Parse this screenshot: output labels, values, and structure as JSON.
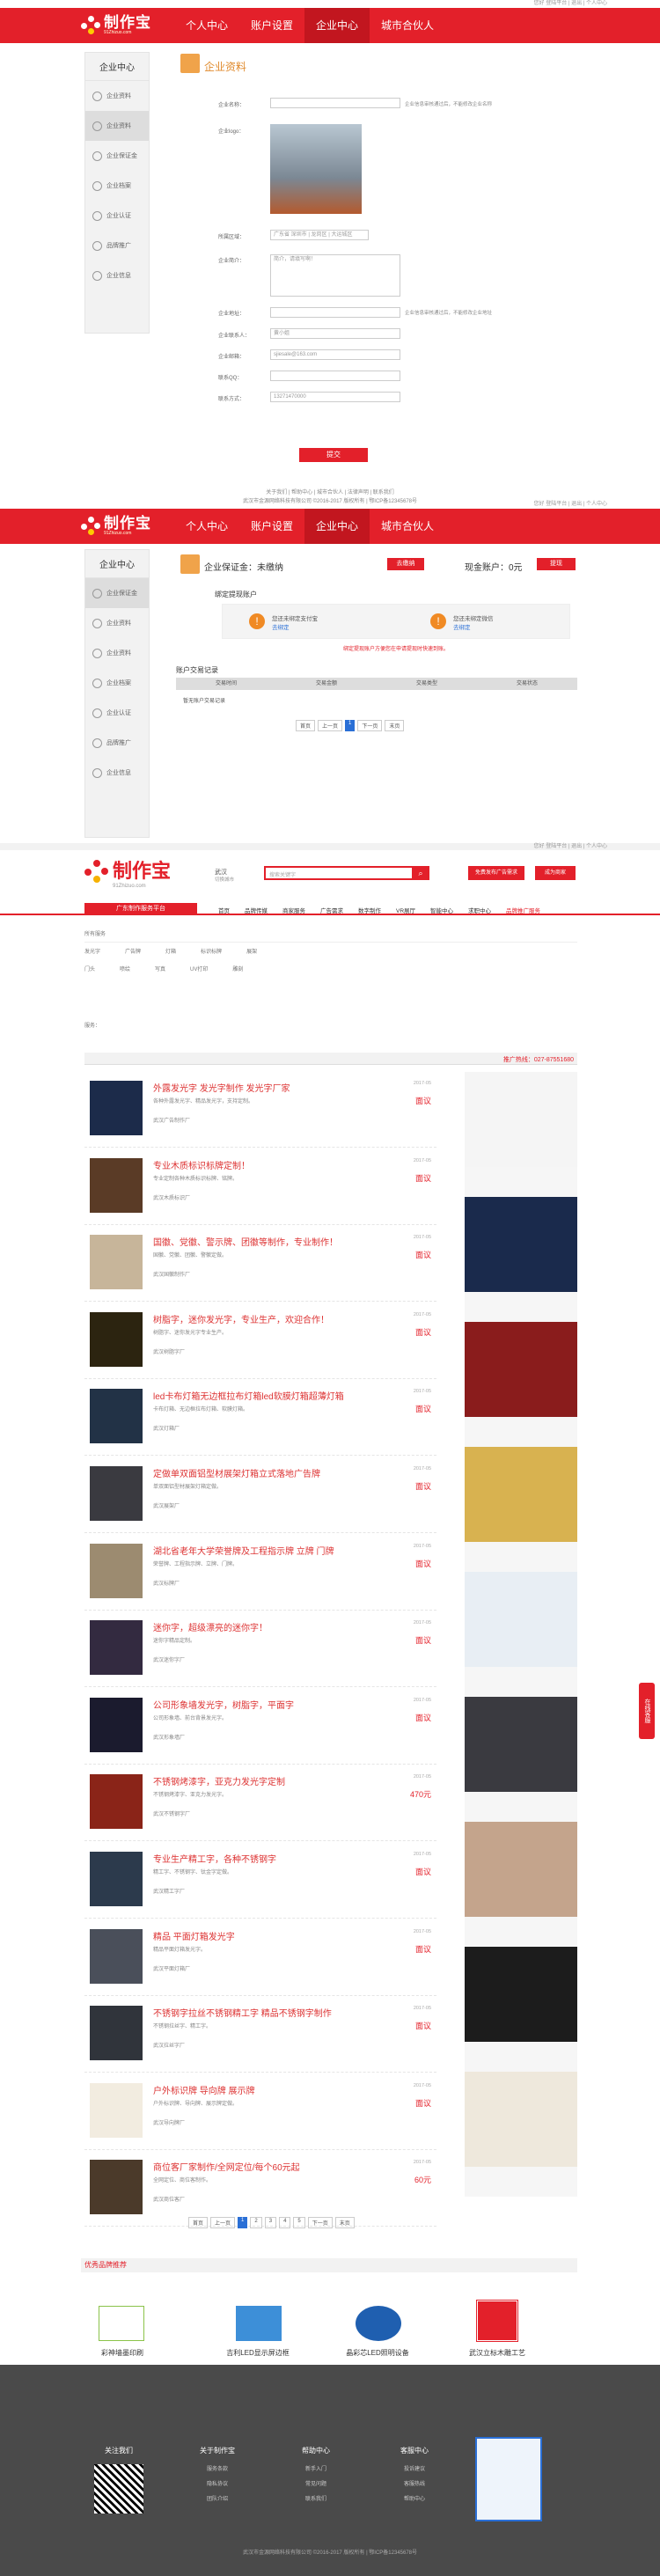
{
  "top_links": "您好 登陆平台 | 退出 | 个人中心",
  "logo": {
    "name": "制作宝",
    "url": "91Zhizuo.com"
  },
  "main_nav": [
    "个人中心",
    "账户设置",
    "企业中心",
    "城市合伙人"
  ],
  "sidebar": {
    "title": "企业中心",
    "items": [
      "企业资料",
      "企业资料",
      "企业保证金",
      "企业档案",
      "企业认证",
      "品牌推广",
      "企业信息"
    ]
  },
  "section1": {
    "title": "企业资料",
    "fields": [
      {
        "label": "企业名称：",
        "value": "",
        "tip": "企业信息审核通过后，不能修改企业名称"
      },
      {
        "label": "企业logo：",
        "value": ""
      },
      {
        "label": "所属区域：",
        "value": "广东省 深圳市 | 龙岗区 | 大运城区"
      },
      {
        "label": "企业简介：",
        "value": "简介，请填写啊！"
      },
      {
        "label": "企业地址：",
        "value": "",
        "tip": "企业信息审核通过后，不能修改企业地址"
      },
      {
        "label": "企业联系人：",
        "value": "黄小姐"
      },
      {
        "label": "企业邮箱：",
        "value": "sjiesale@163.com"
      },
      {
        "label": "联系QQ：",
        "value": ""
      },
      {
        "label": "联系方式：",
        "value": "13271470000"
      }
    ],
    "submit": "提交",
    "footer": "关于我们 | 帮助中心 | 城市合伙人 | 法律声明 | 联系我们",
    "copyright": "武汉市金源网络科技有限公司 ©2016-2017 版权所有 | 鄂ICP备12345678号"
  },
  "section2": {
    "deposit_label": "企业保证金：未缴纳",
    "deposit_btn": "去缴纳",
    "cash_label": "现金账户：0元",
    "cash_btn": "提现",
    "bind_title": "绑定提现账户",
    "bind1": "您还未绑定支付宝",
    "bind1_link": "去绑定",
    "bind2": "您还未绑定微信",
    "bind2_link": "去绑定",
    "notice": "绑定提现账户方便您在申请提现时快速到账。",
    "records_title": "账户交易记录",
    "cols": [
      "交易时间",
      "交易金额",
      "交易类型",
      "交易状态"
    ],
    "empty": "暂无账户交易记录",
    "pager": [
      "首页",
      "上一页",
      "1",
      "下一页",
      "末页"
    ]
  },
  "section3": {
    "site_tag": "广东制作服务平台",
    "city": "武汉",
    "city_sub": "切换城市",
    "search_placeholder": "搜索关键字",
    "search_btn": "搜索",
    "btn_publish": "免费发布广告需求",
    "btn_join": "成为商家",
    "nav": [
      "首页",
      "品牌传媒",
      "商家服务",
      "广告需求",
      "数字制作",
      "VR展厅",
      "智能中心",
      "求职中心",
      "品牌推广服务"
    ],
    "filter_title": "所有服务",
    "filters": [
      "发光字",
      "广告牌",
      "灯箱",
      "标识标牌",
      "展架",
      "门头",
      "喷绘",
      "写真",
      "UV打印",
      "雕刻"
    ],
    "hot_label": "服务：",
    "hotline": "推广热线：027-87551680",
    "list": [
      {
        "title": "外露发光字 发光字制作 发光字厂家",
        "desc": "各种外露发光字、精品发光字，支持定制。",
        "date": "2017-05",
        "price": "面议",
        "shop": "武汉广告制作厂"
      },
      {
        "title": "专业木质标识标牌定制！",
        "desc": "专业定制各种木质标识标牌、铭牌。",
        "date": "2017-05",
        "price": "面议",
        "shop": "武汉木质标识厂"
      },
      {
        "title": "国徽、党徽、警示牌、团徽等制作，专业制作！",
        "desc": "国徽、党徽、团徽、警徽定做。",
        "date": "2017-05",
        "price": "面议",
        "shop": "武汉国徽制作厂"
      },
      {
        "title": "树脂字，迷你发光字，专业生产，欢迎合作！",
        "desc": "树脂字、迷你发光字专业生产。",
        "date": "2017-05",
        "price": "面议",
        "shop": "武汉树脂字厂"
      },
      {
        "title": "led卡布灯箱无边框拉布灯箱led软膜灯箱超薄灯箱",
        "desc": "卡布灯箱、无边框拉布灯箱、软膜灯箱。",
        "date": "2017-05",
        "price": "面议",
        "shop": "武汉灯箱厂"
      },
      {
        "title": "定做单双面铝型材展架灯箱立式落地广告牌",
        "desc": "单双面铝型材展架灯箱定做。",
        "date": "2017-05",
        "price": "面议",
        "shop": "武汉展架厂"
      },
      {
        "title": "湖北省老年大学荣誉牌及工程指示牌 立牌 门牌",
        "desc": "荣誉牌、工程指示牌、立牌、门牌。",
        "date": "2017-05",
        "price": "面议",
        "shop": "武汉标牌厂"
      },
      {
        "title": "迷你字，超级漂亮的迷你字！",
        "desc": "迷你字精品定制。",
        "date": "2017-05",
        "price": "面议",
        "shop": "武汉迷你字厂"
      },
      {
        "title": "公司形象墙发光字，树脂字，平面字",
        "desc": "公司形象墙、前台背景发光字。",
        "date": "2017-05",
        "price": "面议",
        "shop": "武汉形象墙厂"
      },
      {
        "title": "不锈钢烤漆字，亚克力发光字定制",
        "desc": "不锈钢烤漆字、亚克力发光字。",
        "date": "2017-05",
        "price": "470元",
        "shop": "武汉不锈钢字厂"
      },
      {
        "title": "专业生产精工字，各种不锈钢字",
        "desc": "精工字、不锈钢字、钛金字定做。",
        "date": "2017-05",
        "price": "面议",
        "shop": "武汉精工字厂"
      },
      {
        "title": "精品 平面灯箱发光字",
        "desc": "精品平面灯箱发光字。",
        "date": "2017-05",
        "price": "面议",
        "shop": "武汉平面灯箱厂"
      },
      {
        "title": "不锈钢字拉丝不锈钢精工字 精品不锈钢字制作",
        "desc": "不锈钢拉丝字、精工字。",
        "date": "2017-05",
        "price": "面议",
        "shop": "武汉拉丝字厂"
      },
      {
        "title": "户外标识牌 导向牌 展示牌",
        "desc": "户外标识牌、导向牌、展示牌定做。",
        "date": "2017-05",
        "price": "面议",
        "shop": "武汉导向牌厂"
      },
      {
        "title": "商位客厂家制作/全网定位/每个60元起",
        "desc": "全网定位、商位客制作。",
        "date": "2017-05",
        "price": "60元",
        "shop": "武汉商位客厂"
      }
    ],
    "list_pager": [
      "首页",
      "上一页",
      "1",
      "2",
      "3",
      "4",
      "5",
      "下一页",
      "末页"
    ],
    "brand_title": "优秀品牌推荐",
    "brands": [
      "彩神墙墨印刷",
      "吉利LED显示屏边框",
      "晶彩芯LED照明设备",
      "武汉立标木雕工艺"
    ],
    "footer_cols": [
      {
        "h": "关注我们",
        "items": []
      },
      {
        "h": "关于制作宝",
        "items": [
          "服务条款",
          "隐私协议",
          "团队介绍"
        ]
      },
      {
        "h": "帮助中心",
        "items": [
          "新手入门",
          "常见问题",
          "联系我们"
        ]
      },
      {
        "h": "客服中心",
        "items": [
          "投诉建议",
          "客服热线",
          "帮助中心"
        ]
      }
    ],
    "bottom_copyright": "武汉市金源网络科技有限公司 ©2016-2017 版权所有 | 鄂ICP备12345678号",
    "float_btn": "在线客服"
  }
}
